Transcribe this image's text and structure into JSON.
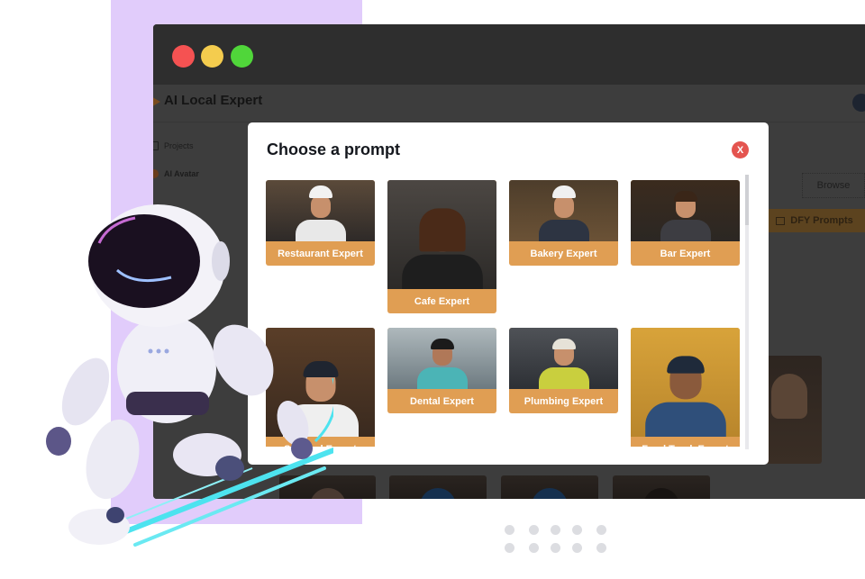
{
  "window": {
    "controls": [
      "close",
      "minimize",
      "maximize"
    ],
    "colors": {
      "close": "#f55252",
      "minimize": "#f4cc4e",
      "maximize": "#50d63a"
    }
  },
  "app": {
    "title": "AI Local Expert",
    "sidebar": [
      {
        "label": "Projects",
        "icon": "folder-icon"
      },
      {
        "label": "AI Avatar",
        "icon": "avatar-icon"
      }
    ],
    "browse_label": "Browse",
    "dfy_label": "DFY Prompts"
  },
  "modal": {
    "title": "Choose a prompt",
    "close_label": "X",
    "accent": "#e09e53",
    "cards": [
      {
        "label": "Restaurant Expert"
      },
      {
        "label": "Cafe Expert"
      },
      {
        "label": "Bakery Expert"
      },
      {
        "label": "Bar Expert"
      },
      {
        "label": "Seafood Expert"
      },
      {
        "label": "Dental Expert"
      },
      {
        "label": "Plumbing Expert"
      },
      {
        "label": "Food Truck Expert"
      }
    ]
  }
}
